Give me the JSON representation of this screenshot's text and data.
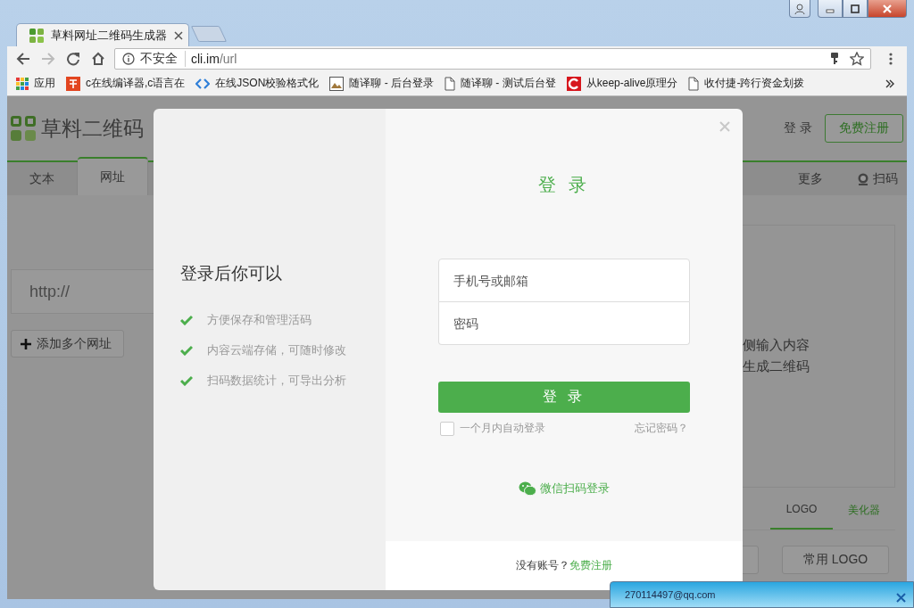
{
  "browser": {
    "tabs": [
      {
        "title": "草料网址二维码生成器",
        "selected": true
      }
    ],
    "address": {
      "security": "不安全",
      "host": "cli.im",
      "path": "/url"
    },
    "bookmarks": [
      {
        "kind": "apps",
        "label": "应用"
      },
      {
        "kind": "book",
        "label": "c在线编译器,c语言在"
      },
      {
        "kind": "code",
        "label": "在线JSON校验格式化"
      },
      {
        "kind": "image",
        "label": "随译聊 - 后台登录"
      },
      {
        "kind": "page",
        "label": "随译聊 - 测试后台登"
      },
      {
        "kind": "c",
        "label": "从keep-alive原理分"
      },
      {
        "kind": "page",
        "label": "收付捷-跨行资金划拨"
      }
    ]
  },
  "page": {
    "logo": "草料二维码",
    "login": "登 录",
    "register": "免费注册",
    "nav_tabs": [
      {
        "label": "文本",
        "selected": false
      },
      {
        "label": "网址",
        "selected": true
      }
    ],
    "nav_right": [
      {
        "kind": "text",
        "label": "更多"
      },
      {
        "kind": "scan",
        "label": "扫码"
      }
    ],
    "url_input": {
      "placeholder": "http://"
    },
    "add_button": "添加多个网址",
    "preview_lines": [
      "侧输入内容",
      "生成二维码"
    ],
    "style_tabs": [
      {
        "label": "LOGO",
        "selected": true,
        "kind": "plain"
      },
      {
        "label": "美化器",
        "selected": false,
        "kind": "accent"
      }
    ],
    "logo_button": "常用 LOGO"
  },
  "modal": {
    "promo_title": "登录后你可以",
    "benefits": [
      "方便保存和管理活码",
      "内容云端存储，可随时修改",
      "扫码数据统计，可导出分析"
    ],
    "title": "登 录",
    "username": {
      "placeholder": "手机号或邮箱"
    },
    "password": {
      "placeholder": "密码"
    },
    "submit": "登 录",
    "remember": {
      "label": "一个月内自动登录",
      "checked": false
    },
    "forgot": "忘记密码？",
    "wechat": "微信扫码登录",
    "footer": {
      "prompt": "没有账号？",
      "link": "免费注册"
    }
  },
  "notification": {
    "text": "270114497@qq.com"
  }
}
